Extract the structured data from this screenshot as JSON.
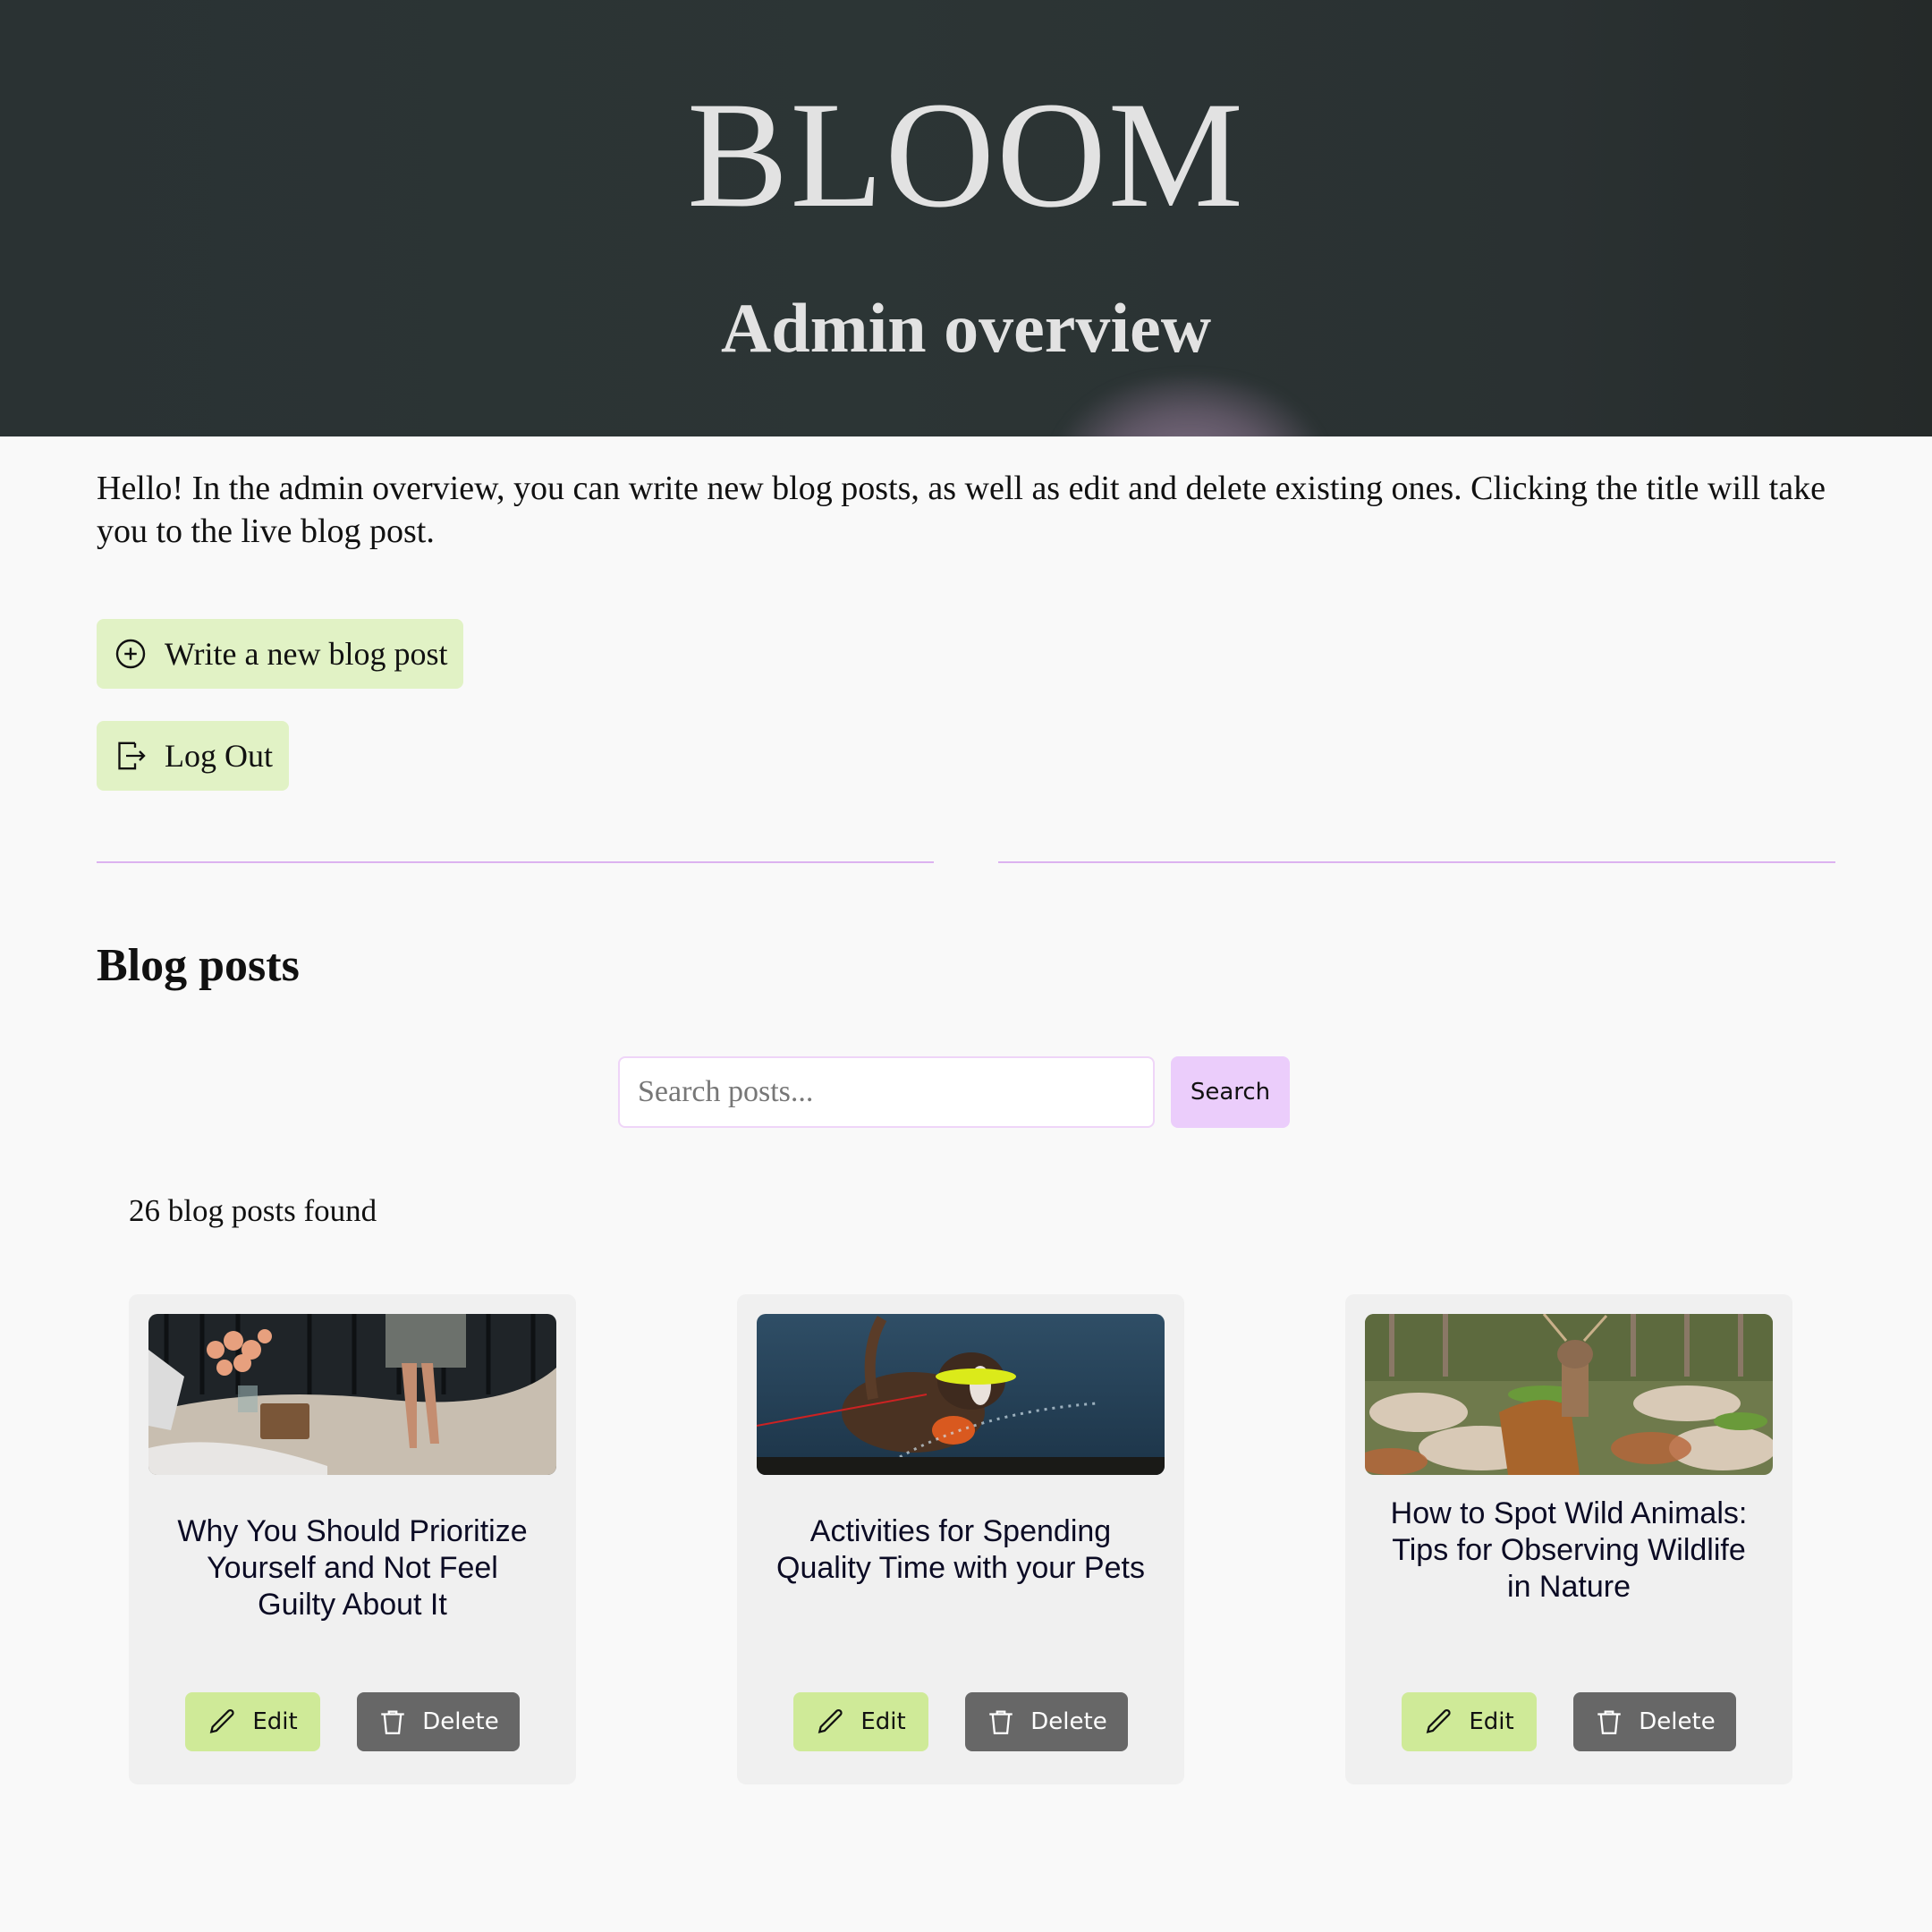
{
  "header": {
    "brand": "BLOOM",
    "subtitle": "Admin overview"
  },
  "intro_text": "Hello! In the admin overview, you can write new blog posts, as well as edit and delete existing ones. Clicking the title will take you to the live blog post.",
  "actions": {
    "write_label": "Write a new blog post",
    "write_icon": "plus-circle-icon",
    "logout_label": "Log Out",
    "logout_icon": "logout-icon"
  },
  "section_title": "Blog posts",
  "search": {
    "placeholder": "Search posts...",
    "value": "",
    "button_label": "Search"
  },
  "results_count": "26 blog posts found",
  "posts": [
    {
      "title": "Why You Should Prioritize Yourself and Not Feel Guilty About It",
      "image": "woman-barefoot-on-blanket-with-roses-photo",
      "edit_label": "Edit",
      "delete_label": "Delete"
    },
    {
      "title": "Activities for Spending Quality Time with your Pets",
      "image": "dog-with-frisbee-in-water-photo",
      "edit_label": "Edit",
      "delete_label": "Delete"
    },
    {
      "title": "How to Spot Wild Animals: Tips for Observing Wildlife in Nature",
      "image": "spotted-deer-in-forest-photo",
      "edit_label": "Edit",
      "delete_label": "Delete"
    }
  ],
  "colors": {
    "hero_bg": "#2b3334",
    "button_green": "#e1f2c5",
    "edit_green": "#cfea98",
    "delete_gray": "#676767",
    "accent_purple": "#dcb2f0",
    "search_btn": "#ebcdfb",
    "card_bg": "#f0f0f0",
    "page_bg": "#f9f9f9"
  }
}
